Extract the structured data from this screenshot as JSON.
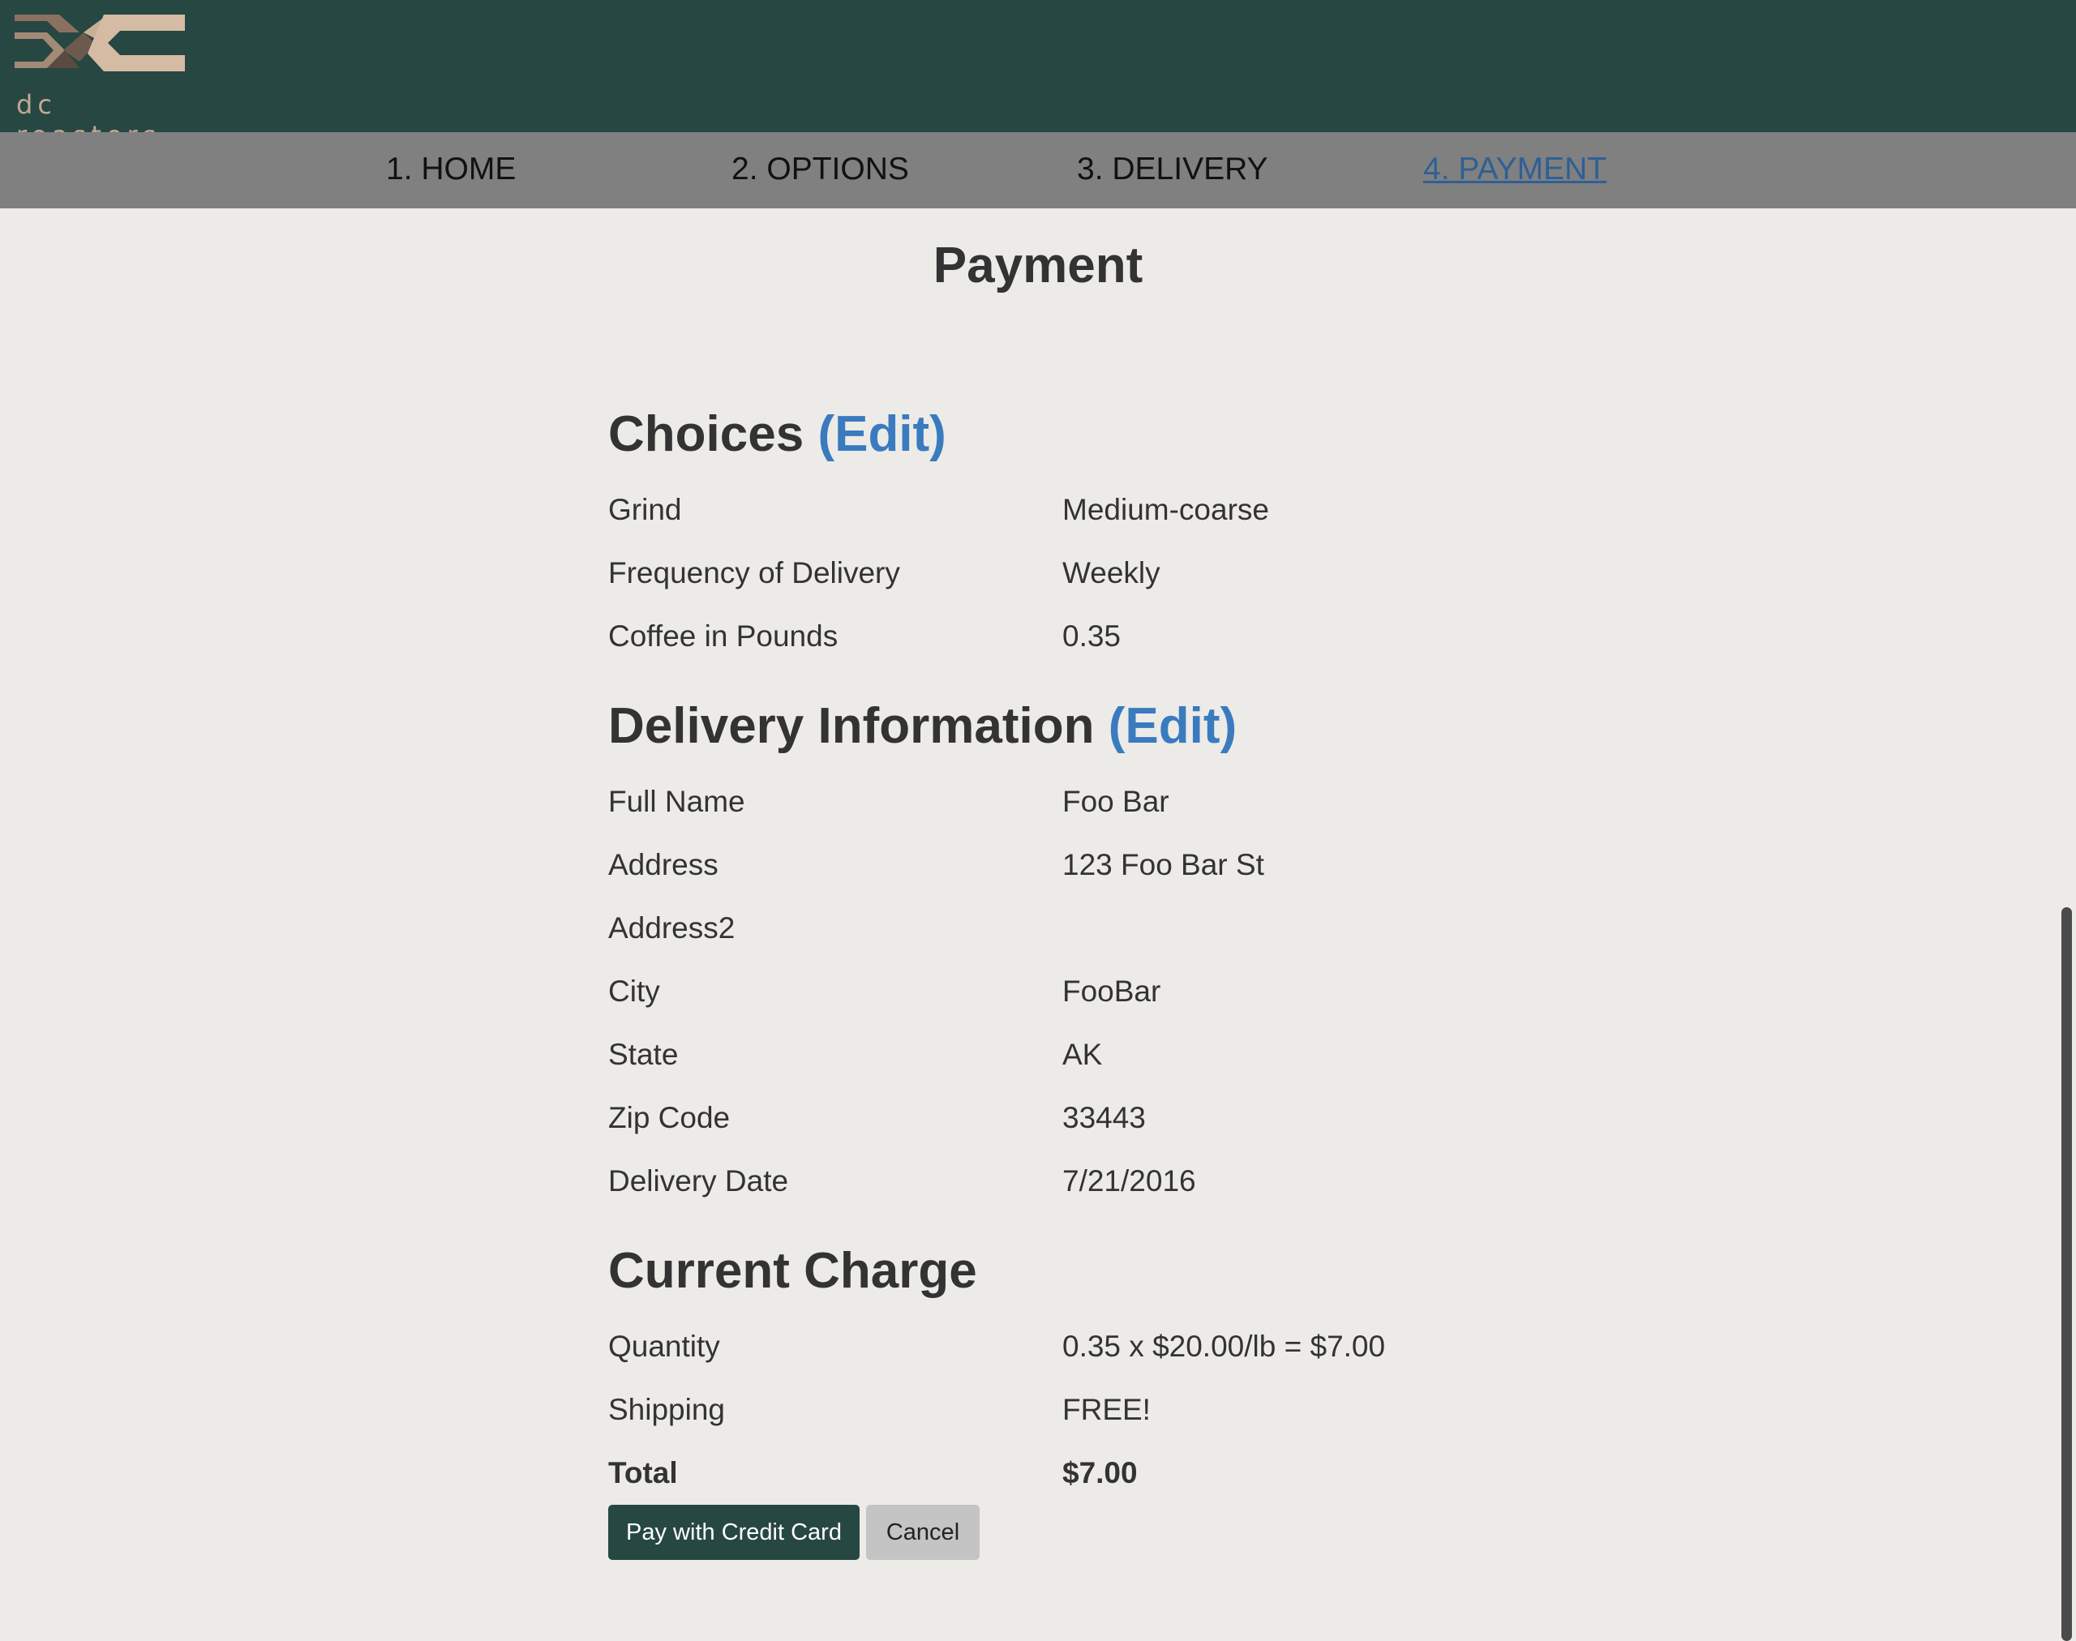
{
  "brand": {
    "logo_text": "dc roasters"
  },
  "nav": {
    "items": [
      {
        "label": "1. HOME"
      },
      {
        "label": "2. OPTIONS"
      },
      {
        "label": "3. DELIVERY"
      },
      {
        "label": "4. PAYMENT",
        "active": true
      }
    ]
  },
  "page": {
    "title": "Payment"
  },
  "choices": {
    "heading": "Choices",
    "edit_label": "(Edit)",
    "rows": [
      {
        "label": "Grind",
        "value": "Medium-coarse"
      },
      {
        "label": "Frequency of Delivery",
        "value": "Weekly"
      },
      {
        "label": "Coffee in Pounds",
        "value": "0.35"
      }
    ]
  },
  "delivery": {
    "heading": "Delivery Information",
    "edit_label": "(Edit)",
    "rows": [
      {
        "label": "Full Name",
        "value": "Foo Bar"
      },
      {
        "label": "Address",
        "value": "123 Foo Bar St"
      },
      {
        "label": "Address2",
        "value": ""
      },
      {
        "label": "City",
        "value": "FooBar"
      },
      {
        "label": "State",
        "value": "AK"
      },
      {
        "label": "Zip Code",
        "value": "33443"
      },
      {
        "label": "Delivery Date",
        "value": "7/21/2016"
      }
    ]
  },
  "charge": {
    "heading": "Current Charge",
    "rows": [
      {
        "label": "Quantity",
        "value": "0.35 x $20.00/lb = $7.00"
      },
      {
        "label": "Shipping",
        "value": "FREE!"
      },
      {
        "label": "Total",
        "value": "$7.00"
      }
    ]
  },
  "actions": {
    "pay_label": "Pay with Credit Card",
    "cancel_label": "Cancel"
  },
  "colors": {
    "header_bg": "#274743",
    "nav_bg": "#808080",
    "page_bg": "#ecebe7",
    "link": "#3a7bbf",
    "active_nav": "#2f5f95"
  }
}
